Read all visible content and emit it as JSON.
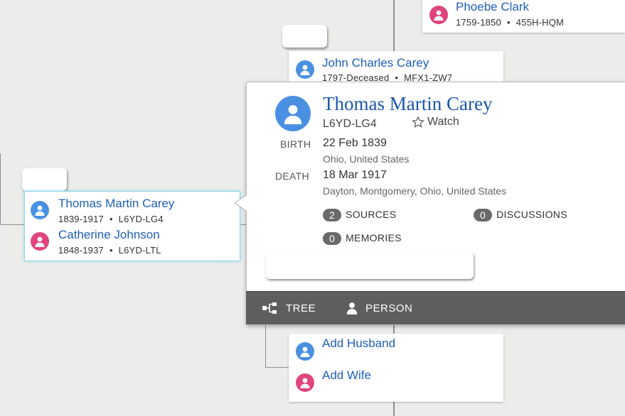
{
  "top_card": {
    "name": "Phoebe Clark",
    "dates": "1759-1850",
    "id": "455H-HQM",
    "gender": "female"
  },
  "father_card": {
    "name": "John Charles Carey",
    "dates": "1797-Deceased",
    "id": "MFX1-ZW7",
    "gender": "male"
  },
  "couple_card": {
    "husband": {
      "name": "Thomas Martin Carey",
      "dates": "1839-1917",
      "id": "L6YD-LG4"
    },
    "wife": {
      "name": "Catherine Johnson",
      "dates": "1848-1937",
      "id": "L6YD-LTL"
    }
  },
  "popup": {
    "name": "Thomas Martin Carey",
    "id": "L6YD-LG4",
    "watch_label": "Watch",
    "birth_label": "BIRTH",
    "birth_date": "22 Feb 1839",
    "birth_place": "Ohio, United States",
    "death_label": "DEATH",
    "death_date": "18 Mar 1917",
    "death_place": "Dayton, Montgomery, Ohio, United States",
    "sources_count": "2",
    "sources_label": "SOURCES",
    "discussions_count": "0",
    "discussions_label": "DISCUSSIONS",
    "memories_count": "0",
    "memories_label": "MEMORIES",
    "tree_label": "TREE",
    "person_label": "PERSON"
  },
  "add_card": {
    "add_husband": "Add Husband",
    "add_wife": "Add Wife"
  },
  "colors": {
    "link": "#1f5fb8",
    "male": "#4a90e2",
    "female": "#e0447c",
    "toolbar": "#5e5e5e",
    "selected_border": "#8fd6e8"
  },
  "icons": [
    "person-icon",
    "star-icon",
    "tree-icon"
  ]
}
